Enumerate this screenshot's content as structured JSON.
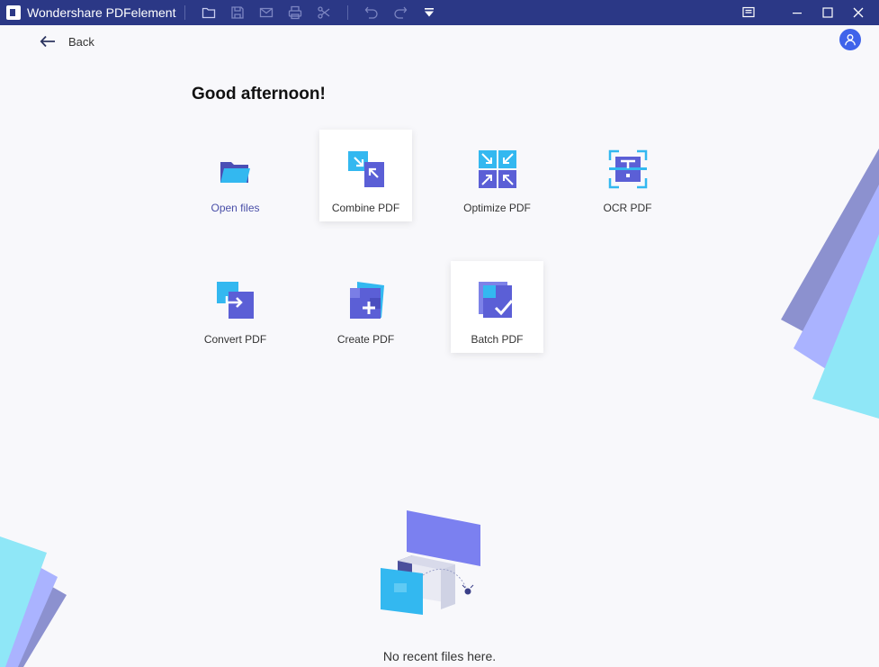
{
  "window": {
    "title": "Wondershare PDFelement",
    "toolbar_icons": [
      "folder-icon",
      "save-icon",
      "mail-icon",
      "print-icon",
      "scissors-icon",
      "undo-icon",
      "redo-icon",
      "dropdown-icon"
    ],
    "controls": [
      "feedback-icon",
      "minimize-icon",
      "maximize-icon",
      "close-icon"
    ]
  },
  "header": {
    "back_label": "Back",
    "greeting": "Good afternoon!"
  },
  "tiles": [
    {
      "label": "Open files",
      "icon": "folder-open-icon"
    },
    {
      "label": "Combine PDF",
      "icon": "combine-icon"
    },
    {
      "label": "Optimize PDF",
      "icon": "optimize-icon"
    },
    {
      "label": "OCR PDF",
      "icon": "ocr-icon"
    },
    {
      "label": "Convert PDF",
      "icon": "convert-icon"
    },
    {
      "label": "Create PDF",
      "icon": "create-icon"
    },
    {
      "label": "Batch PDF",
      "icon": "batch-icon"
    }
  ],
  "recent": {
    "empty_message": "No recent files here."
  },
  "colors": {
    "titlebar": "#2b3886",
    "accent": "#5b5fd6",
    "cyan": "#33b8f0",
    "avatar": "#3f63ea"
  }
}
